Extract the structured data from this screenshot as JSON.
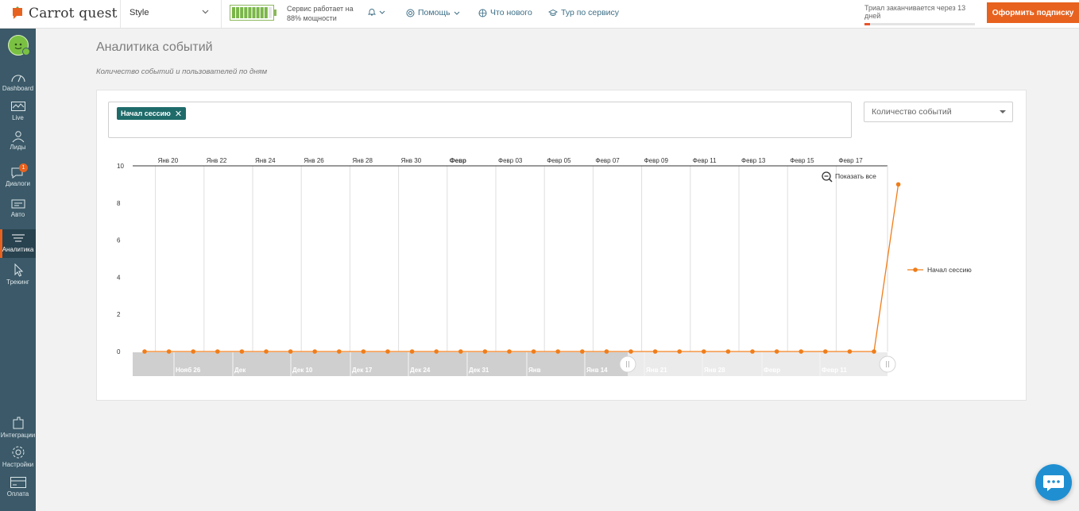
{
  "header": {
    "brand": "Carrot quest",
    "app_select": "Style",
    "service_line1": "Сервис работает на",
    "service_line2": "88% мощности",
    "power_percent": 88,
    "help": "Помощь",
    "whats_new": "Что нового",
    "tour": "Тур по сервису",
    "trial_text": "Триал заканчивается через 13 дней",
    "trial_progress": 0.05,
    "subscribe": "Оформить подписку"
  },
  "sidebar": {
    "items": [
      {
        "label": "Dashboard",
        "icon": "dashboard-icon"
      },
      {
        "label": "Live",
        "icon": "live-icon"
      },
      {
        "label": "Лиды",
        "icon": "leads-icon"
      },
      {
        "label": "Диалоги",
        "icon": "dialogs-icon",
        "badge": "1"
      },
      {
        "label": "Авто",
        "icon": "auto-icon"
      },
      {
        "label": "Аналитика",
        "icon": "analytics-icon",
        "active": true
      },
      {
        "label": "Трекинг",
        "icon": "tracking-icon"
      },
      {
        "label": "Интеграции",
        "icon": "integrations-icon"
      },
      {
        "label": "Настройки",
        "icon": "settings-icon"
      },
      {
        "label": "Оплата",
        "icon": "payment-icon"
      }
    ]
  },
  "page": {
    "title": "Аналитика событий",
    "subtitle": "Количество событий и пользователей по дням"
  },
  "filter": {
    "event_tag": "Начал сессию",
    "metric": "Количество событий"
  },
  "colors": {
    "accent": "#e8621f",
    "sidebar": "#3b5968",
    "tag": "#1e6b6a",
    "series": "#f07d1a"
  },
  "chart_data": {
    "type": "line",
    "y_ticks": [
      "0",
      "2",
      "4",
      "6",
      "8",
      "10"
    ],
    "ylim": [
      0,
      10
    ],
    "x_top_labels": [
      "Янв 20",
      "Янв 22",
      "Янв 24",
      "Янв 26",
      "Янв 28",
      "Янв 30",
      "Февр",
      "Февр 03",
      "Февр 05",
      "Февр 07",
      "Февр 09",
      "Февр 11",
      "Февр 13",
      "Февр 15",
      "Февр 17"
    ],
    "series": [
      {
        "name": "Начал сессию",
        "x": [
          "Янв 19",
          "Янв 20",
          "Янв 21",
          "Янв 22",
          "Янв 23",
          "Янв 24",
          "Янв 25",
          "Янв 26",
          "Янв 27",
          "Янв 28",
          "Янв 29",
          "Янв 30",
          "Янв 31",
          "Февр 01",
          "Февр 02",
          "Февр 03",
          "Февр 04",
          "Февр 05",
          "Февр 06",
          "Февр 07",
          "Февр 08",
          "Февр 09",
          "Февр 10",
          "Февр 11",
          "Февр 12",
          "Февр 13",
          "Февр 14",
          "Февр 15",
          "Февр 16",
          "Февр 17",
          "Февр 18",
          "Февр 19"
        ],
        "values": [
          0,
          0,
          0,
          0,
          0,
          0,
          0,
          0,
          0,
          0,
          0,
          0,
          0,
          0,
          0,
          0,
          0,
          0,
          0,
          0,
          0,
          0,
          0,
          0,
          0,
          0,
          0,
          0,
          0,
          0,
          0,
          9
        ]
      }
    ],
    "navigator_labels": [
      "Нояб 26",
      "Дек",
      "Дек 10",
      "Дек 17",
      "Дек 24",
      "Дек 31",
      "Янв",
      "Янв 14",
      "Янв 21",
      "Янв 28",
      "Февр",
      "Февр 11"
    ],
    "navigator_selection": [
      "Янв 19",
      "Февр 19"
    ],
    "zoom_reset": "Показать все",
    "legend_position": "right",
    "grid": true
  },
  "chat": {
    "icon": "chat-bubble-icon"
  }
}
